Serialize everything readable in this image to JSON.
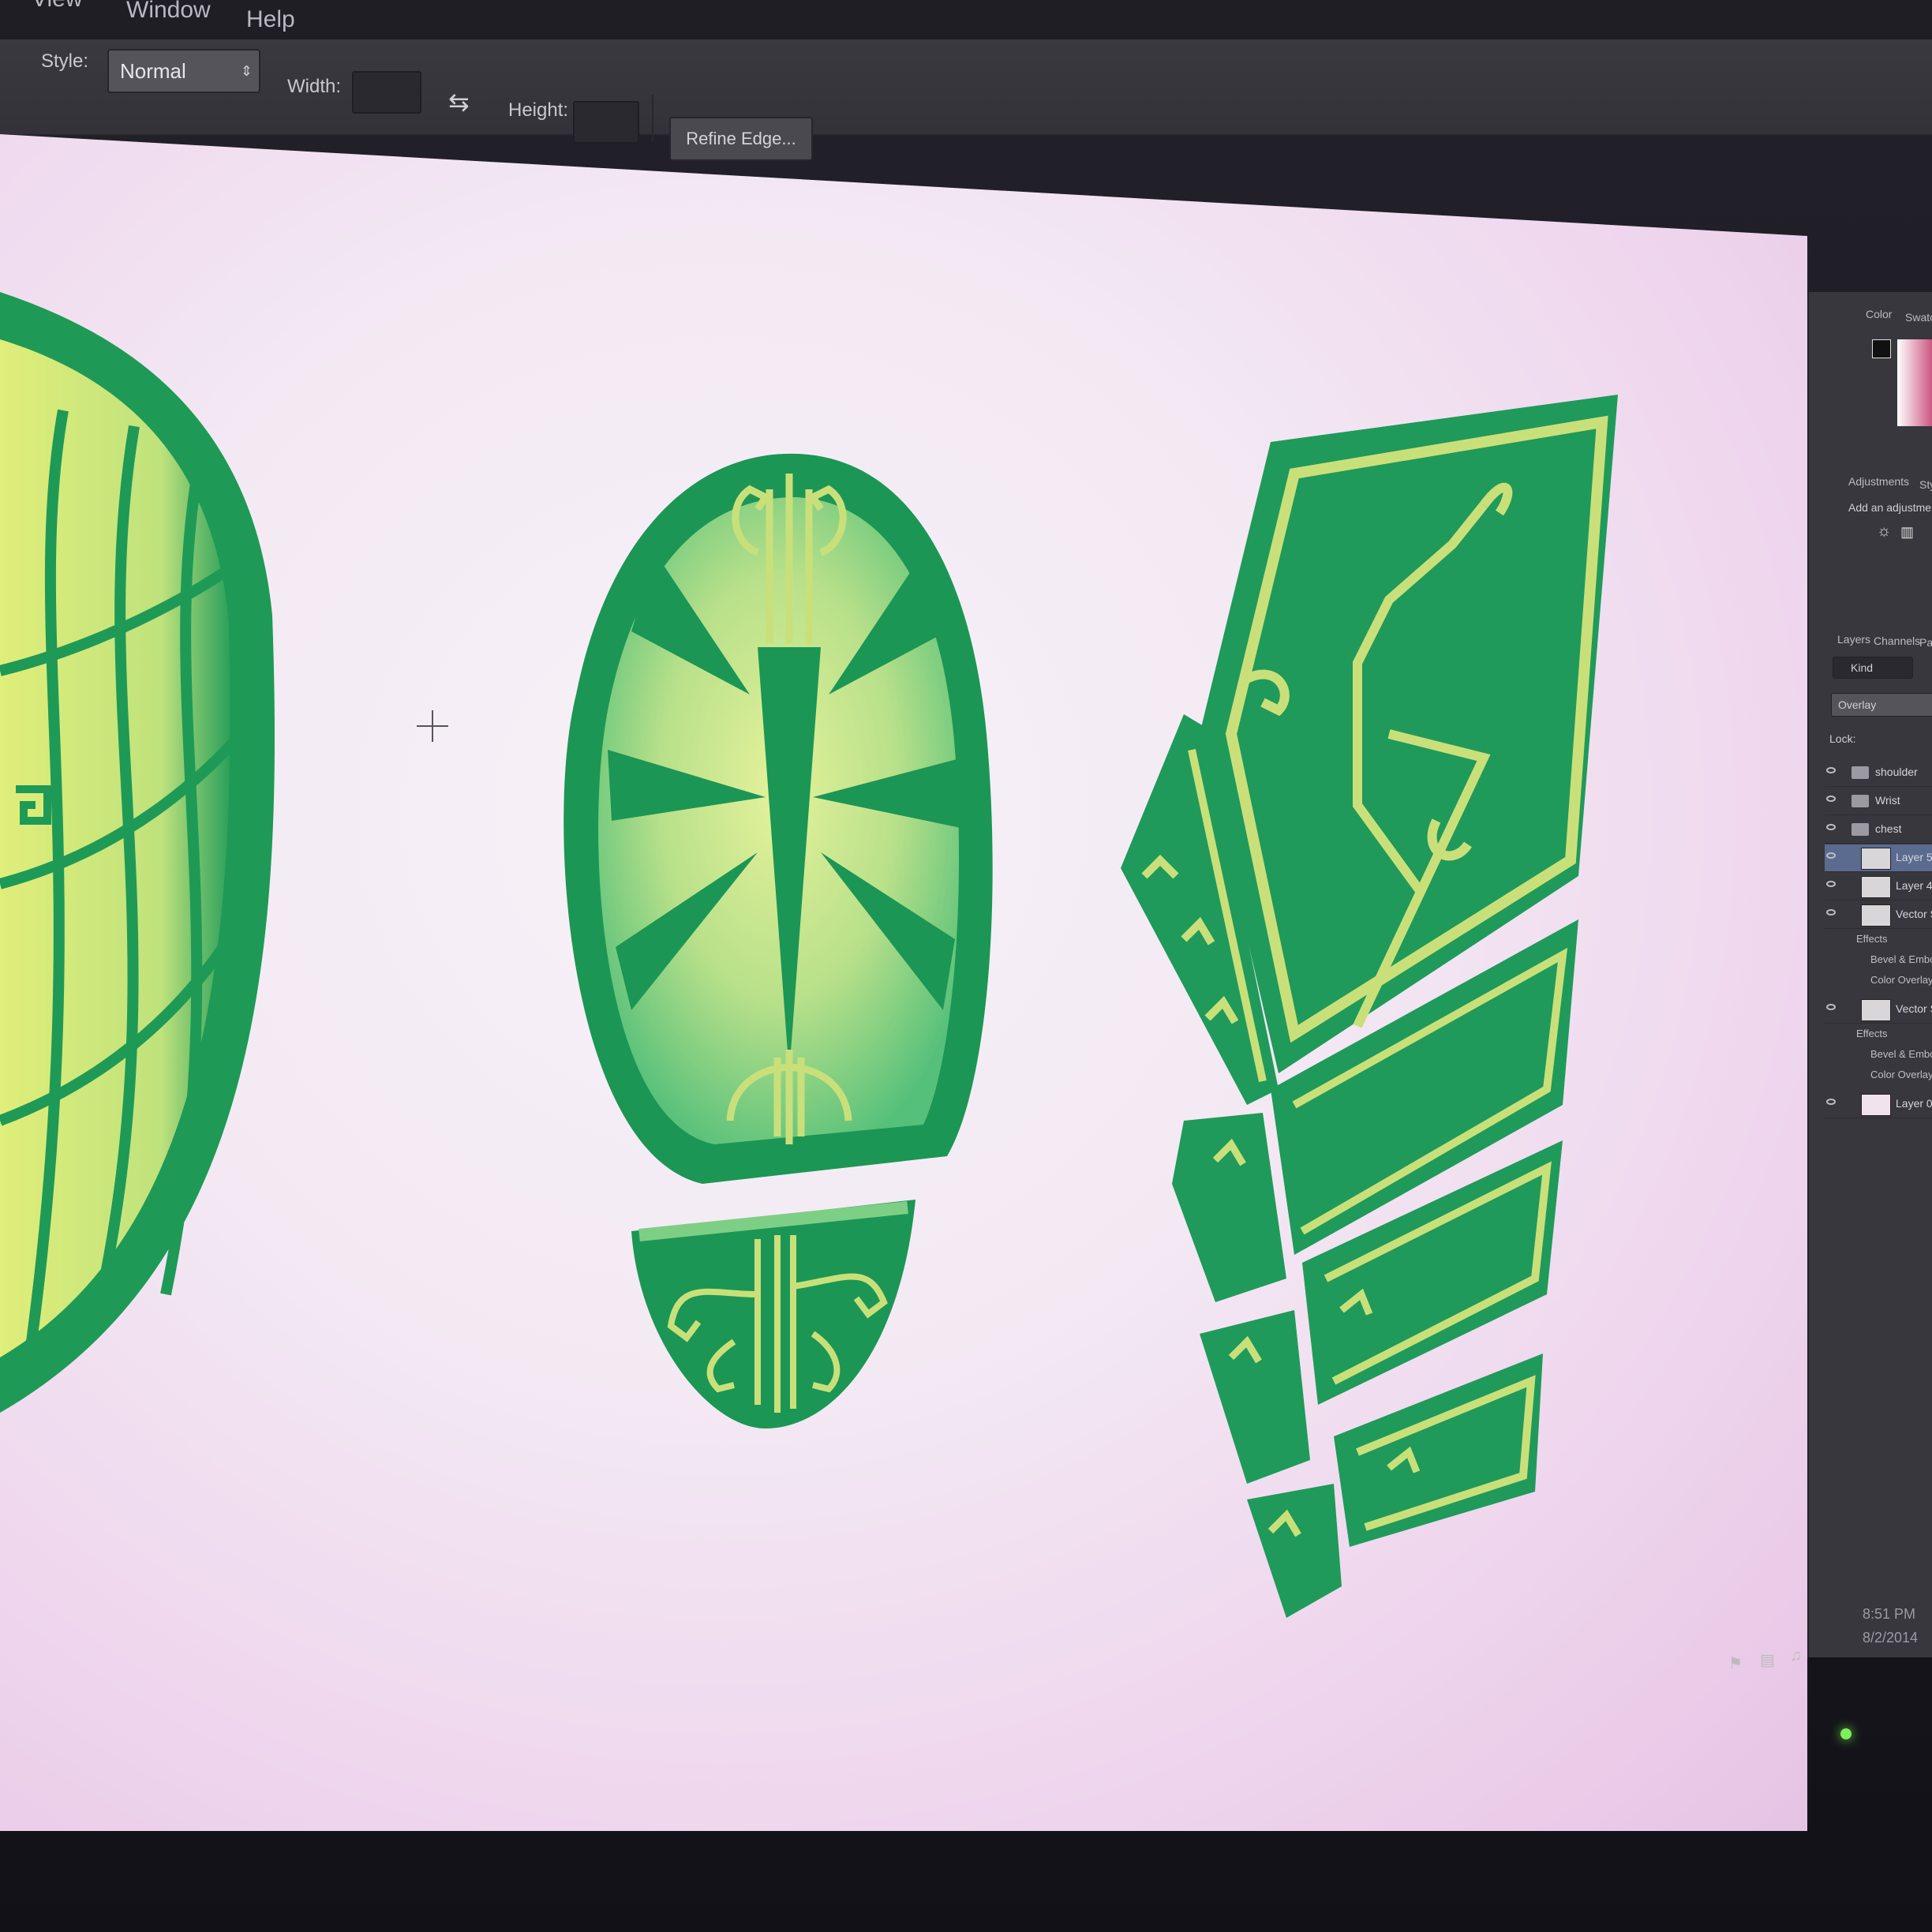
{
  "menu": {
    "items": [
      "View",
      "Window",
      "Help"
    ]
  },
  "options": {
    "style_label": "Style:",
    "style_value": "Normal",
    "width_label": "Width:",
    "height_label": "Height:",
    "refine_edge_label": "Refine Edge..."
  },
  "panels": {
    "color_tab": "Color",
    "swatches_tab": "Swatches",
    "adjustments_tab": "Adjustments",
    "styles_tab": "Styles",
    "add_adjustment": "Add an adjustment",
    "layers_tab": "Layers",
    "channels_tab": "Channels",
    "paths_tab": "Paths",
    "filter_kind": "Kind",
    "blend_mode": "Overlay",
    "lock_label": "Lock:",
    "layers": [
      {
        "name": "shoulder",
        "type": "folder"
      },
      {
        "name": "Wrist",
        "type": "folder"
      },
      {
        "name": "chest",
        "type": "folder-open"
      },
      {
        "name": "Layer 5",
        "type": "layer",
        "selected": true
      },
      {
        "name": "Layer 4",
        "type": "layer"
      },
      {
        "name": "Vector Smart Object",
        "type": "layer"
      },
      {
        "name": "Effects",
        "type": "sub"
      },
      {
        "name": "Bevel & Emboss",
        "type": "sub2"
      },
      {
        "name": "Color Overlay",
        "type": "sub2"
      },
      {
        "name": "Vector Smart Object",
        "type": "layer"
      },
      {
        "name": "Effects",
        "type": "sub"
      },
      {
        "name": "Bevel & Emboss",
        "type": "sub2"
      },
      {
        "name": "Color Overlay",
        "type": "sub2"
      },
      {
        "name": "Layer 0",
        "type": "layer"
      }
    ]
  },
  "tray": {
    "time": "8:51 PM",
    "date": "8/2/2014"
  },
  "colors": {
    "armor_green": "#1f9a5a",
    "armor_dark": "#178549",
    "trim_yellow": "#c9e07a",
    "leaf_light": "#d9ee8a",
    "canvas_bg": "#f5eef6",
    "panel_bg": "#38373d",
    "selected_layer": "#5a6b8f"
  }
}
